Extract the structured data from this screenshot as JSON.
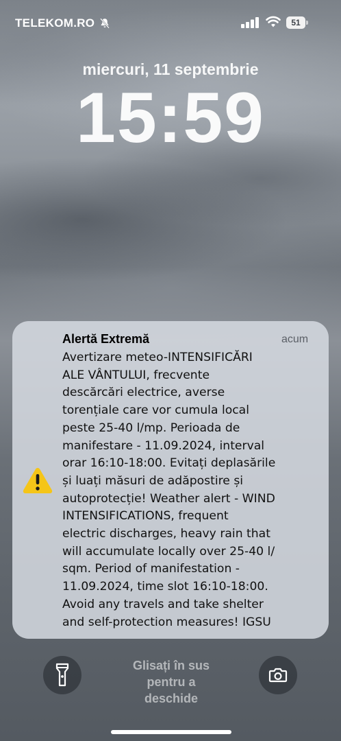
{
  "status_bar": {
    "carrier": "TELEKOM.RO",
    "battery_percent": "51",
    "icons": [
      "bell-off-icon",
      "signal-icon",
      "wifi-icon",
      "battery-icon"
    ]
  },
  "lock_screen": {
    "date": "miercuri, 11 septembrie",
    "time": "15:59"
  },
  "notification": {
    "title": "Alertă Extremă",
    "time": "acum",
    "icon": "warning-icon",
    "body": "Avertizare meteo-INTENSIFICĂRI\nALE VÂNTULUI, frecvente\ndescărcări electrice, averse\ntorențiale care vor cumula local\npeste 25-40 l/mp. Perioada de\nmanifestare - 11.09.2024, interval\norar 16:10-18:00. Evitați deplasările\nși luați măsuri de adăpostire și\nautoprotecție! Weather alert - WIND\nINTENSIFICATIONS, frequent\nelectric discharges, heavy rain that\nwill accumulate locally over 25-40 l/\nsqm. Period of manifestation -\n11.09.2024, time slot 16:10-18:00.\nAvoid any travels and take shelter\nand self-protection measures! IGSU",
    "accent_color": "#f5c518"
  },
  "bottom_bar": {
    "swipe_hint": "Glisați în sus\npentru a\ndeschide",
    "left_button_icon": "flashlight-icon",
    "right_button_icon": "camera-icon"
  }
}
